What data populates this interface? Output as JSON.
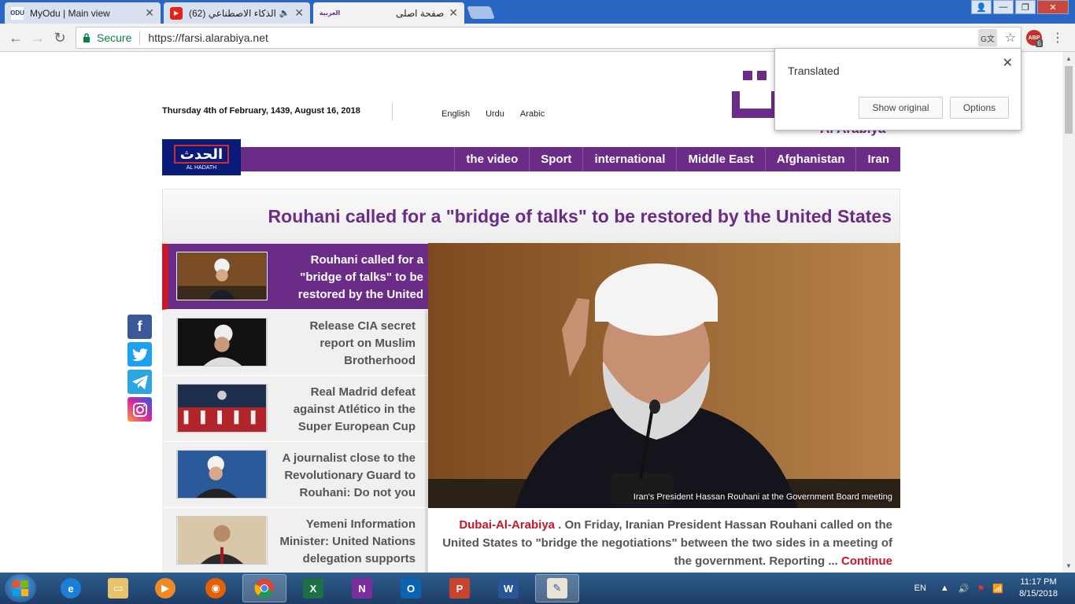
{
  "browser": {
    "tabs": [
      {
        "title": "MyOdu | Main view",
        "favicon": "ODU",
        "active": false
      },
      {
        "title": "(62) الحصاد-الذكاء الاصطناعي",
        "favicon": "youtube-icon",
        "active": false
      },
      {
        "title": "صفحة اصلی",
        "favicon": "العربية",
        "active": true
      }
    ],
    "secure_label": "Secure",
    "url": "https://farsi.alarabiya.net",
    "extension_badge": "6"
  },
  "translate_popup": {
    "title": "Translated",
    "show_original": "Show original",
    "options": "Options"
  },
  "site": {
    "date": "Thursday 4th of February, 1439, August 16, 2018",
    "languages": [
      "English",
      "Urdu",
      "Arabic"
    ],
    "logo_text": "Al Arabiya",
    "hadath": {
      "ar": "الحدث",
      "en": "AL HADATH"
    },
    "nav": [
      "the video",
      "Sport",
      "international",
      "Middle East",
      "Afghanistan",
      "Iran"
    ],
    "headline": "Rouhani called for a \"bridge of talks\" to be restored by the United States",
    "stories": [
      {
        "title": "Rouhani called for a \"bridge of talks\" to be restored by the United"
      },
      {
        "title": "Release CIA secret report on Muslim Brotherhood"
      },
      {
        "title": "Real Madrid defeat against Atlético in the Super European Cup"
      },
      {
        "title": "A journalist close to the Revolutionary Guard to Rouhani: Do not you"
      },
      {
        "title": "Yemeni Information Minister: United Nations delegation supports"
      }
    ],
    "hero_caption": "Iran's President Hassan Rouhani at the Government Board meeting",
    "summary_source": "Dubai-Al-Arabiya",
    "summary_text": " . On Friday, Iranian President Hassan Rouhani called on the United States to \"bridge the negotiations\" between the two sides in a meeting of the government. Reporting ... ",
    "summary_more": "Continue"
  },
  "taskbar": {
    "language": "EN",
    "time": "11:17 PM",
    "date": "8/15/2018",
    "apps": [
      "internet-explorer",
      "file-explorer",
      "media-player",
      "firefox",
      "chrome",
      "excel",
      "onenote",
      "outlook",
      "powerpoint",
      "word",
      "paint"
    ]
  }
}
